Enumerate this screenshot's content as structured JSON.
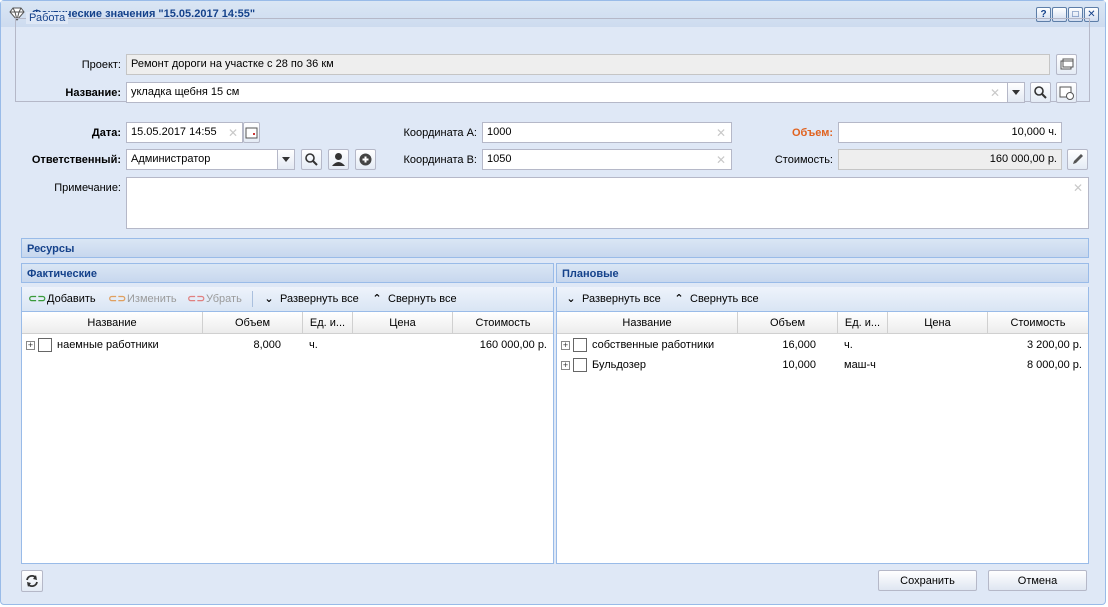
{
  "window": {
    "title": "Фактические значения \"15.05.2017 14:55\"",
    "controls": [
      "?",
      "_",
      "□",
      "✕"
    ]
  },
  "work": {
    "legend": "Работа",
    "project_label": "Проект:",
    "project_value": "Ремонт дороги на участке с 28 по 36 км",
    "name_label": "Название:",
    "name_value": "укладка щебня 15 см"
  },
  "form": {
    "date_label": "Дата:",
    "date_value": "15.05.2017 14:55",
    "responsible_label": "Ответственный:",
    "responsible_value": "Администратор",
    "coord_a_label": "Координата А:",
    "coord_a_value": "1000",
    "coord_b_label": "Координата В:",
    "coord_b_value": "1050",
    "volume_label": "Объем:",
    "volume_value": "10,000 ч.",
    "cost_label": "Стоимость:",
    "cost_value": "160 000,00 р.",
    "note_label": "Примечание:",
    "note_value": ""
  },
  "resources": {
    "title": "Ресурсы",
    "actual": {
      "title": "Фактические",
      "toolbar": {
        "add": "Добавить",
        "edit": "Изменить",
        "remove": "Убрать",
        "expand": "Развернуть все",
        "collapse": "Свернуть все"
      },
      "columns": [
        "Название",
        "Объем",
        "Ед. и...",
        "Цена",
        "Стоимость"
      ],
      "rows": [
        {
          "name": "наемные работники",
          "volume": "8,000",
          "unit": "ч.",
          "price": "",
          "cost": "160 000,00 р."
        }
      ]
    },
    "planned": {
      "title": "Плановые",
      "toolbar": {
        "expand": "Развернуть все",
        "collapse": "Свернуть все"
      },
      "columns": [
        "Название",
        "Объем",
        "Ед. и...",
        "Цена",
        "Стоимость"
      ],
      "rows": [
        {
          "name": "собственные работники",
          "volume": "16,000",
          "unit": "ч.",
          "price": "",
          "cost": "3 200,00 р."
        },
        {
          "name": "Бульдозер",
          "volume": "10,000",
          "unit": "маш-ч",
          "price": "",
          "cost": "8 000,00 р."
        }
      ]
    }
  },
  "footer": {
    "save": "Сохранить",
    "cancel": "Отмена"
  }
}
